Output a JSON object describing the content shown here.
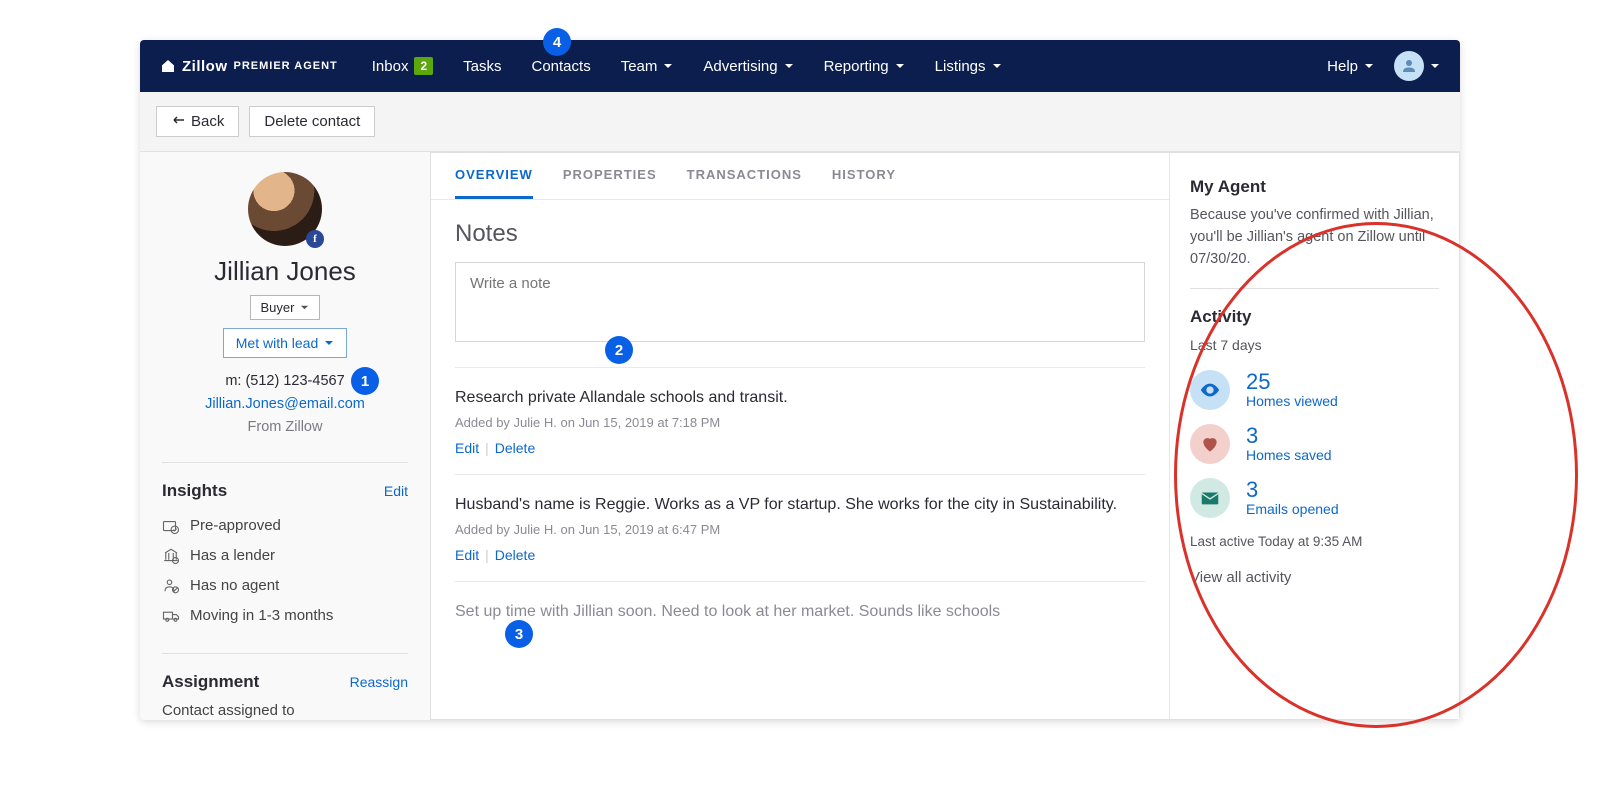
{
  "brand": {
    "name": "Zillow",
    "sub": "PREMIER AGENT"
  },
  "nav": {
    "items": [
      {
        "label": "Inbox",
        "badge": "2",
        "dropdown": false
      },
      {
        "label": "Tasks",
        "dropdown": false
      },
      {
        "label": "Contacts",
        "dropdown": false
      },
      {
        "label": "Team",
        "dropdown": true
      },
      {
        "label": "Advertising",
        "dropdown": true
      },
      {
        "label": "Reporting",
        "dropdown": true
      },
      {
        "label": "Listings",
        "dropdown": true
      }
    ],
    "help": "Help"
  },
  "toolbar": {
    "back": "Back",
    "delete": "Delete contact"
  },
  "contact": {
    "name": "Jillian Jones",
    "type": "Buyer",
    "status": "Met with lead",
    "phone": "m: (512) 123-4567",
    "email": "Jillian.Jones@email.com",
    "source": "From Zillow"
  },
  "insights": {
    "title": "Insights",
    "edit": "Edit",
    "items": [
      "Pre-approved",
      "Has a lender",
      "Has no agent",
      "Moving in 1-3 months"
    ]
  },
  "assignment": {
    "title": "Assignment",
    "action": "Reassign",
    "text": "Contact assigned to"
  },
  "tabs": [
    "OVERVIEW",
    "PROPERTIES",
    "TRANSACTIONS",
    "HISTORY"
  ],
  "notes": {
    "title": "Notes",
    "placeholder": "Write a note",
    "edit": "Edit",
    "delete": "Delete",
    "items": [
      {
        "text": "Research private Allandale schools and transit.",
        "meta": "Added by Julie H. on Jun 15, 2019 at 7:18 PM"
      },
      {
        "text": "Husband's name is Reggie. Works as a VP for startup. She works for the city in Sustainability.",
        "meta": "Added by Julie H. on Jun 15, 2019 at 6:47 PM"
      },
      {
        "text": "Set up time with Jillian soon. Need to look at her market. Sounds like schools",
        "meta": ""
      }
    ]
  },
  "myagent": {
    "title": "My Agent",
    "text": "Because you've confirmed with Jillian, you'll be Jillian's agent on Zillow until 07/30/20."
  },
  "activity": {
    "title": "Activity",
    "period": "Last 7 days",
    "items": [
      {
        "count": "25",
        "label": "Homes viewed",
        "iconBg": "#c6e0f5",
        "iconFill": "#0d68cc",
        "icon": "eye"
      },
      {
        "count": "3",
        "label": "Homes saved",
        "iconBg": "#f3d0cc",
        "iconFill": "#b0534a",
        "icon": "heart"
      },
      {
        "count": "3",
        "label": "Emails opened",
        "iconBg": "#d0e9e2",
        "iconFill": "#1a7a6a",
        "icon": "mail"
      }
    ],
    "last_active": "Last active Today at 9:35 AM",
    "view_all": "View all activity"
  },
  "annotations": {
    "1": "1",
    "2": "2",
    "3": "3",
    "4": "4"
  }
}
